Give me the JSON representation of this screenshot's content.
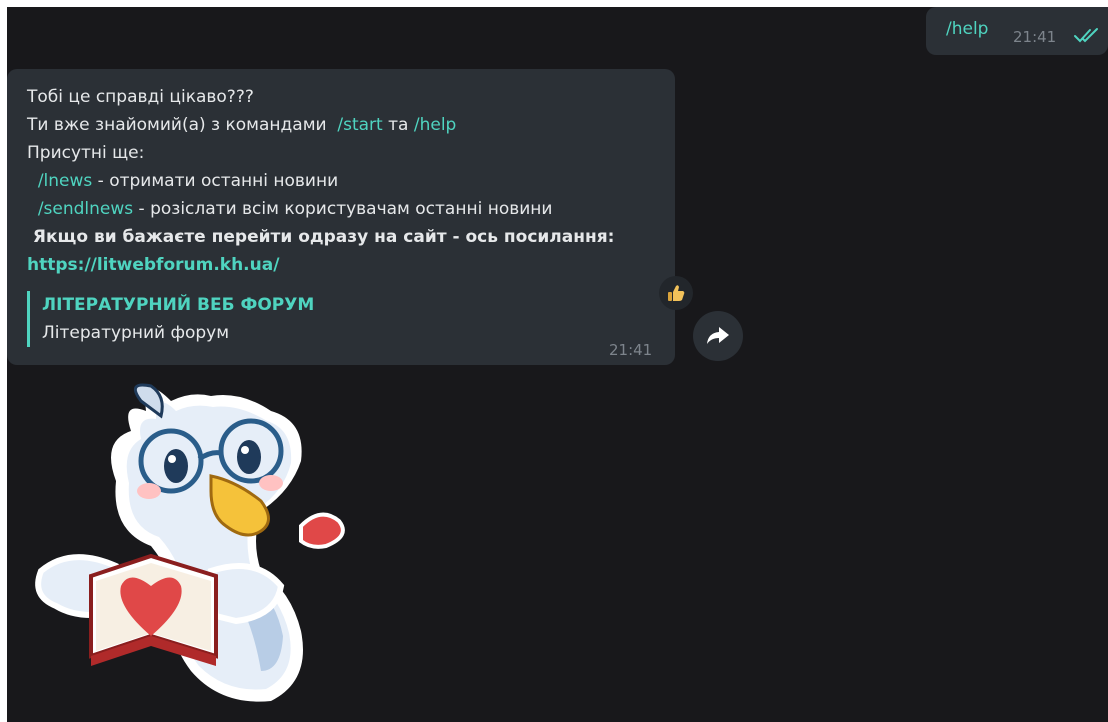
{
  "outgoing": {
    "text": "/help",
    "time": "21:41",
    "status_icon": "double-check-icon"
  },
  "incoming": {
    "line1": "Тобі це справді цікаво???",
    "line2_prefix": "Ти вже знайомий(а) з командами  ",
    "cmd_start": "/start",
    "line2_mid": " та ",
    "cmd_help": "/help",
    "line3": "Присутні ще:",
    "cmd_lnews": "/lnews",
    "lnews_desc": " - отримати останні новини",
    "cmd_sendlnews": "/sendlnews",
    "sendlnews_desc": " - розіслати всім користувачам останні новини",
    "bold_line": " Якщо ви бажаєте перейти одразу на сайт - ось посилання:",
    "link": "https://litwebforum.kh.ua/",
    "preview_title": "ЛІТЕРАТУРНИЙ ВЕБ ФОРУМ",
    "preview_desc": "Літературний форум",
    "time": "21:41",
    "reaction_icon": "thumbs-up-icon"
  },
  "forward_icon": "forward-arrow-icon",
  "sticker": "goose-reading-book-sticker",
  "colors": {
    "background": "#18181b",
    "bubble": "#2b3036",
    "accent": "#4fd4c0",
    "text": "#e6e8ea",
    "meta": "#7d848c"
  }
}
